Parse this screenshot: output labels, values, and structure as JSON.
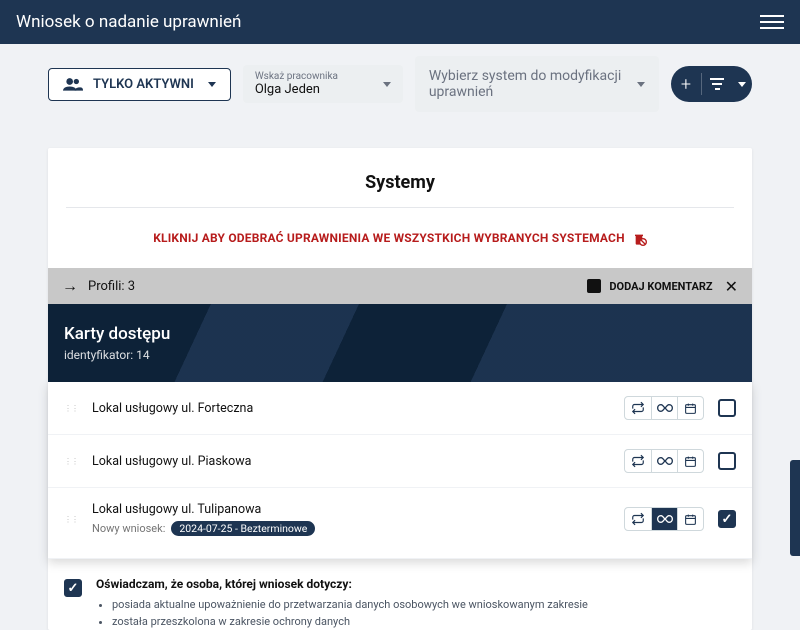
{
  "header": {
    "title": "Wniosek o nadanie uprawnień"
  },
  "toolbar": {
    "only_active_label": "TYLKO AKTYWNI",
    "employee_hint": "Wskaż pracownika",
    "employee_value": "Olga Jeden",
    "system_placeholder": "Wybierz system do modyfikacji uprawnień"
  },
  "main": {
    "section_title": "Systemy",
    "revoke_label": "KLIKNIJ ABY ODEBRAĆ UPRAWNIENIA WE WSZYSTKICH WYBRANYCH SYSTEMACH"
  },
  "profiles_bar": {
    "label": "Profili: 3",
    "add_comment": "DODAJ KOMENTARZ"
  },
  "panel": {
    "title": "Karty dostępu",
    "subtitle": "identyfikator: 14"
  },
  "rows": [
    {
      "title": "Lokal usługowy ul. Forteczna",
      "checked": false,
      "active_icon": null
    },
    {
      "title": "Lokal usługowy ul. Piaskowa",
      "checked": false,
      "active_icon": null
    },
    {
      "title": "Lokal usługowy ul. Tulipanowa",
      "sub_label": "Nowy wniosek:",
      "chip": "2024-07-25 - Bezterminowe",
      "checked": true,
      "active_icon": 1
    }
  ],
  "declaration": {
    "title": "Oświadczam, że osoba, której wniosek dotyczy:",
    "items": [
      "posiada aktualne upoważnienie do przetwarzania danych osobowych we wnioskowanym zakresie",
      "została przeszkolona w zakresie ochrony danych"
    ],
    "checked": true
  }
}
